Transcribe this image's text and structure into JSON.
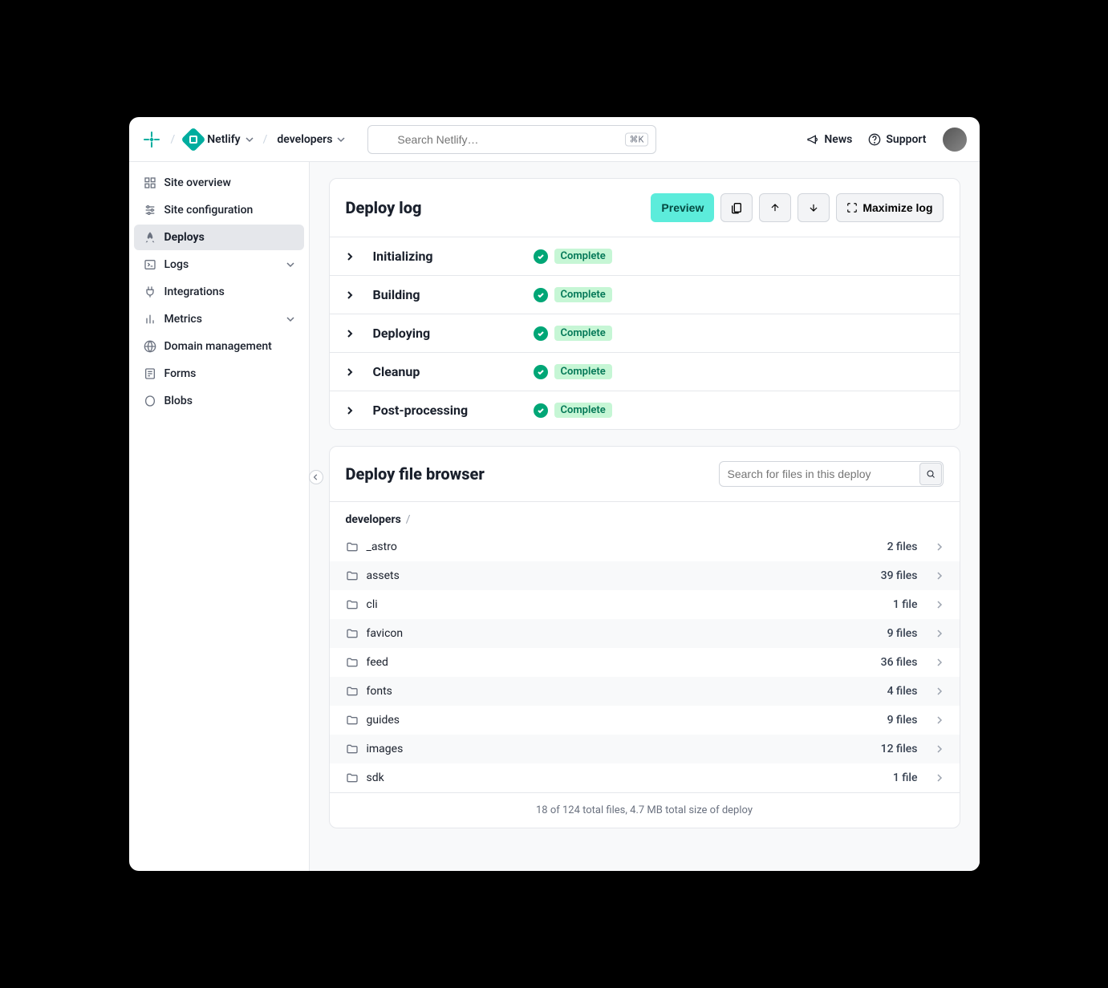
{
  "header": {
    "team": "Netlify",
    "project": "developers",
    "search_placeholder": "Search Netlify…",
    "search_kbd": "⌘K",
    "news": "News",
    "support": "Support"
  },
  "sidebar": {
    "items": [
      {
        "label": "Site overview",
        "icon": "grid"
      },
      {
        "label": "Site configuration",
        "icon": "sliders"
      },
      {
        "label": "Deploys",
        "icon": "rocket",
        "active": true
      },
      {
        "label": "Logs",
        "icon": "terminal",
        "expandable": true
      },
      {
        "label": "Integrations",
        "icon": "plug"
      },
      {
        "label": "Metrics",
        "icon": "bars",
        "expandable": true
      },
      {
        "label": "Domain management",
        "icon": "globe"
      },
      {
        "label": "Forms",
        "icon": "form"
      },
      {
        "label": "Blobs",
        "icon": "blob"
      }
    ]
  },
  "deploy_log": {
    "title": "Deploy log",
    "preview": "Preview",
    "maximize": "Maximize log",
    "phases": [
      {
        "name": "Initializing",
        "status": "Complete"
      },
      {
        "name": "Building",
        "status": "Complete"
      },
      {
        "name": "Deploying",
        "status": "Complete"
      },
      {
        "name": "Cleanup",
        "status": "Complete"
      },
      {
        "name": "Post-processing",
        "status": "Complete"
      }
    ]
  },
  "file_browser": {
    "title": "Deploy file browser",
    "search_placeholder": "Search for files in this deploy",
    "path_root": "developers",
    "files": [
      {
        "name": "_astro",
        "meta": "2 files"
      },
      {
        "name": "assets",
        "meta": "39 files"
      },
      {
        "name": "cli",
        "meta": "1 file"
      },
      {
        "name": "favicon",
        "meta": "9 files"
      },
      {
        "name": "feed",
        "meta": "36 files"
      },
      {
        "name": "fonts",
        "meta": "4 files"
      },
      {
        "name": "guides",
        "meta": "9 files"
      },
      {
        "name": "images",
        "meta": "12 files"
      },
      {
        "name": "sdk",
        "meta": "1 file"
      }
    ],
    "footer": "18 of 124 total files, 4.7 MB total size of deploy"
  }
}
